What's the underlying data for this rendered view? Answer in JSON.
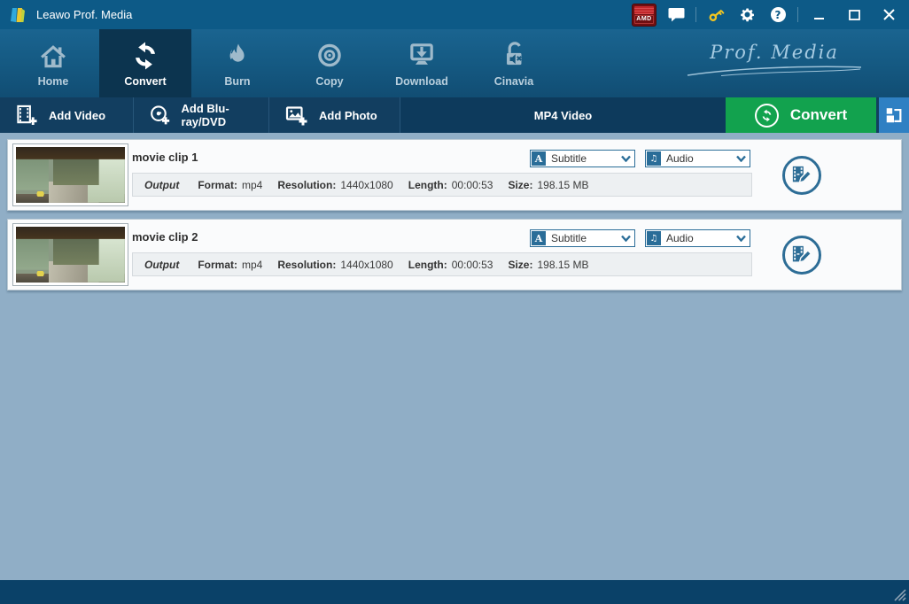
{
  "titlebar": {
    "title": "Leawo Prof. Media",
    "amd_badge_text": "AMD"
  },
  "nav": {
    "tabs": [
      {
        "label": "Home"
      },
      {
        "label": "Convert"
      },
      {
        "label": "Burn"
      },
      {
        "label": "Copy"
      },
      {
        "label": "Download"
      },
      {
        "label": "Cinavia"
      }
    ],
    "active_tab": "Convert",
    "brand": "Prof. Media"
  },
  "toolbar": {
    "add_video": "Add Video",
    "add_bluray": "Add Blu-ray/DVD",
    "add_photo": "Add Photo",
    "format_selected": "MP4 Video",
    "convert": "Convert"
  },
  "labels": {
    "subtitle_select": "Subtitle",
    "audio_select": "Audio",
    "output": "Output",
    "format": "Format:",
    "resolution": "Resolution:",
    "length": "Length:",
    "size": "Size:"
  },
  "clips": [
    {
      "title": "movie clip 1",
      "format": "mp4",
      "resolution": "1440x1080",
      "length": "00:00:53",
      "size": "198.15 MB"
    },
    {
      "title": "movie clip 2",
      "format": "mp4",
      "resolution": "1440x1080",
      "length": "00:00:53",
      "size": "198.15 MB"
    }
  ],
  "colors": {
    "titlebar_blue": "#0d5a87",
    "nav_active_tab": "#0c344f",
    "toolbar_navy": "#123e60",
    "accent_green": "#12a24e",
    "panel_blue": "#2f80c3",
    "content_bg": "#90aec6",
    "dropdown_blue": "#2a6d98"
  }
}
